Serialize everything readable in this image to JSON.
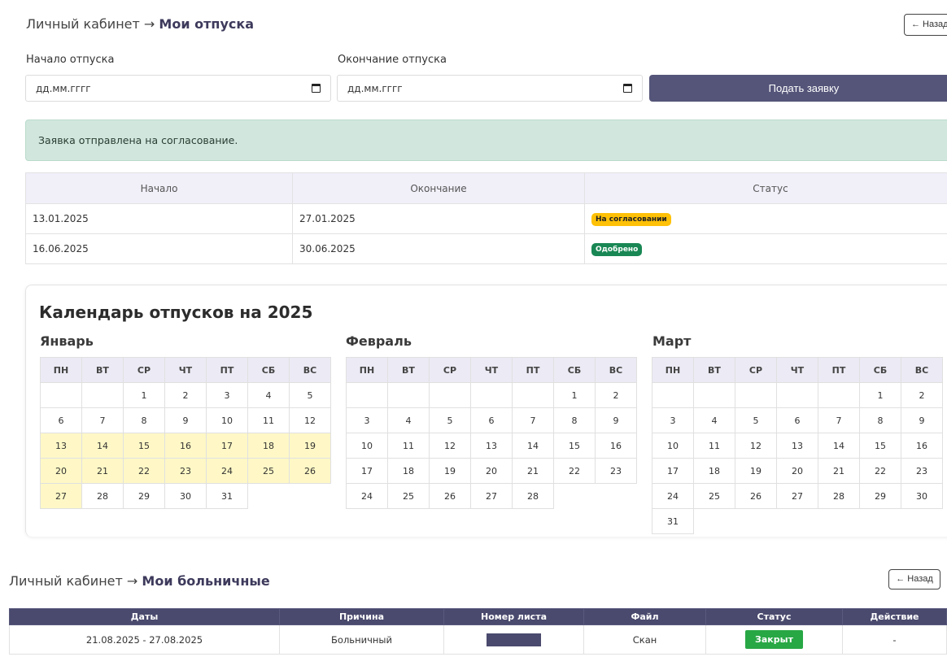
{
  "vacation": {
    "breadcrumb_root": "Личный кабинет",
    "breadcrumb_arrow": "→",
    "breadcrumb_current": "Мои отпуска",
    "back_label": "← Назад",
    "start_label": "Начало отпуска",
    "end_label": "Окончание отпуска",
    "start_placeholder": "дд.мм.гггг",
    "end_placeholder": "дд.мм.гггг",
    "submit_label": "Подать заявку",
    "alert": "Заявка отправлена на согласование.",
    "table": {
      "headers": [
        "Начало",
        "Окончание",
        "Статус"
      ],
      "rows": [
        {
          "start": "13.01.2025",
          "end": "27.01.2025",
          "status": "На согласовании"
        },
        {
          "start": "16.06.2025",
          "end": "30.06.2025",
          "status": "Одобрено"
        }
      ]
    }
  },
  "calendar": {
    "title": "Календарь отпусков на 2025",
    "weekdays": [
      "ПН",
      "ВТ",
      "СР",
      "ЧТ",
      "ПТ",
      "СБ",
      "ВС"
    ],
    "months": [
      {
        "name": "Январь",
        "first_weekday": 2,
        "days": 31,
        "vacation_days": [
          13,
          14,
          15,
          16,
          17,
          18,
          19,
          20,
          21,
          22,
          23,
          24,
          25,
          26,
          27
        ]
      },
      {
        "name": "Февраль",
        "first_weekday": 5,
        "days": 28,
        "vacation_days": []
      },
      {
        "name": "Март",
        "first_weekday": 5,
        "days": 31,
        "vacation_days": []
      }
    ]
  },
  "sick": {
    "breadcrumb_root": "Личный кабинет",
    "breadcrumb_arrow": "→",
    "breadcrumb_current": "Мои больничные",
    "back_label": "← Назад",
    "headers": [
      "Даты",
      "Причина",
      "Номер листа",
      "Файл",
      "Статус",
      "Действие"
    ],
    "row": {
      "dates": "21.08.2025 - 27.08.2025",
      "reason": "Больничный",
      "file": "Скан",
      "status": "Закрыт",
      "action": "-"
    }
  },
  "colors": {
    "primary": "#55557a",
    "vacation_highlight": "#fff8c6",
    "pending": "#ffc107",
    "approved": "#198754",
    "closed": "#28a745"
  }
}
